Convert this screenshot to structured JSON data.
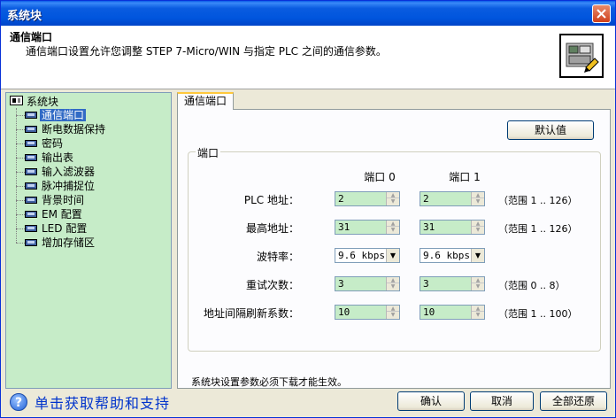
{
  "window": {
    "title": "系统块"
  },
  "header": {
    "title": "通信端口",
    "description": "通信端口设置允许您调整 STEP 7-Micro/WIN 与指定 PLC 之间的通信参数。",
    "icon": "system-block-icon"
  },
  "tree": {
    "root": "系统块",
    "items": [
      {
        "label": "通信端口",
        "selected": true
      },
      {
        "label": "断电数据保持"
      },
      {
        "label": "密码"
      },
      {
        "label": "输出表"
      },
      {
        "label": "输入滤波器"
      },
      {
        "label": "脉冲捕捉位"
      },
      {
        "label": "背景时间"
      },
      {
        "label": "EM 配置"
      },
      {
        "label": "LED 配置"
      },
      {
        "label": "增加存储区"
      }
    ]
  },
  "tab": {
    "label": "通信端口"
  },
  "default_button": "默认值",
  "port_group": {
    "label": "端口",
    "col_port0": "端口 0",
    "col_port1": "端口 1",
    "rows": [
      {
        "label": "PLC 地址：",
        "port0": "2",
        "port1": "2",
        "range": "（范围 1 .. 126）",
        "type": "spin"
      },
      {
        "label": "最高地址：",
        "port0": "31",
        "port1": "31",
        "range": "（范围 1 .. 126）",
        "type": "spin"
      },
      {
        "label": "波特率：",
        "port0": "9.6 kbps",
        "port1": "9.6 kbps",
        "range": "",
        "type": "select"
      },
      {
        "label": "重试次数：",
        "port0": "3",
        "port1": "3",
        "range": "（范围 0 .. 8）",
        "type": "spin"
      },
      {
        "label": "地址间隔刷新系数：",
        "port0": "10",
        "port1": "10",
        "range": "（范围 1 .. 100）",
        "type": "spin"
      }
    ]
  },
  "note": "系统块设置参数必须下载才能生效。",
  "footer": {
    "help_text": "单击获取帮助和支持",
    "ok": "确认",
    "cancel": "取消",
    "restore_all": "全部还原"
  },
  "colors": {
    "titlebar": "#0055dd",
    "tree_bg": "#c6ecc8",
    "field_bg": "#c6ecc8",
    "selection": "#316ac5",
    "help_link": "#0033cc"
  }
}
